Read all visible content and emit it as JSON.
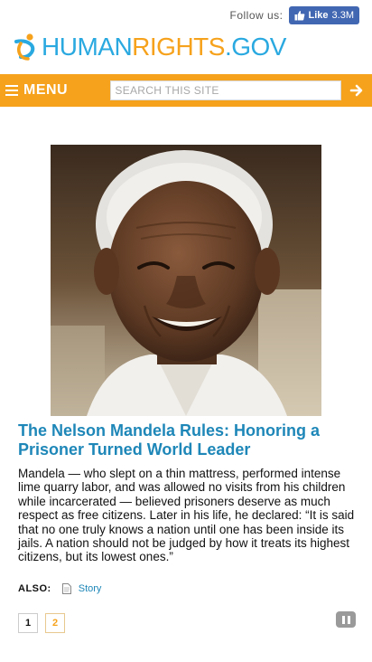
{
  "header": {
    "follow_label": "Follow us:",
    "fb_like_label": "Like",
    "fb_like_count": "3.3M"
  },
  "logo": {
    "part1": "HUMAN",
    "part2": "RIGHTS",
    "part3": ".GOV"
  },
  "nav": {
    "menu_label": "MENU",
    "search_placeholder": "SEARCH THIS SITE",
    "search_icon": "arrow-right-icon"
  },
  "story": {
    "headline": "The Nelson Mandela Rules: Honoring a Prisoner Turned World Leader",
    "summary": "Mandela — who slept on a thin mattress, performed intense lime quarry labor, and was allowed no visits from his children while incarcerated — believed prisoners deserve as much respect as free citizens. Later in his life, he declared: “It is said that no one truly knows a nation until one has been inside its jails. A nation should not be judged by how it treats its highest citizens, but its lowest ones.”",
    "also_label": "ALSO:",
    "also_link": "Story"
  },
  "pager": {
    "pages": [
      "1",
      "2"
    ]
  },
  "colors": {
    "brand_orange": "#f6a21c",
    "brand_blue": "#2aa9e0",
    "link_blue": "#1e87b8",
    "facebook": "#4267b2"
  }
}
